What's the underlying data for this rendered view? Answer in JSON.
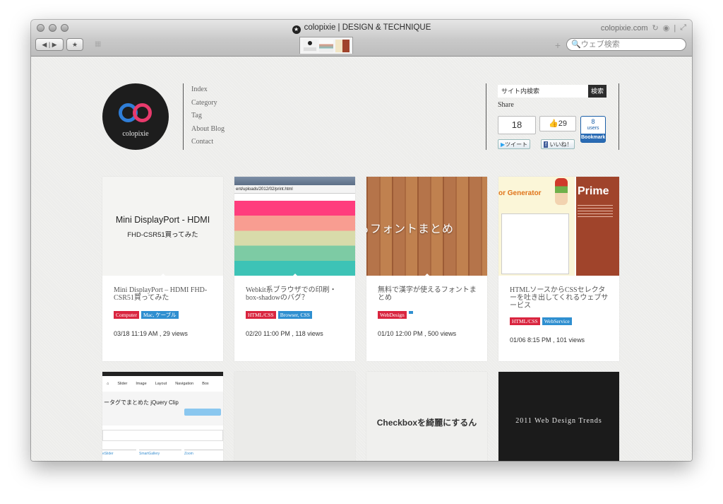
{
  "window": {
    "title": "colopixie | DESIGN & TECHNIQUE",
    "domain": "colopixie.com",
    "search_placeholder": "ウェブ検索"
  },
  "header": {
    "logo_text": "colopixie",
    "menu": [
      "Index",
      "Category",
      "Tag",
      "About Blog",
      "Contact"
    ]
  },
  "sidebar": {
    "search_value": "サイト内検索",
    "search_button": "検索",
    "share_label": "Share",
    "tweet_count": "18",
    "tweet_button": "ツイート",
    "like_count": "29",
    "like_button": "いいね！",
    "hatena_count": "8",
    "hatena_users": "users",
    "hatena_button": "Bookmark"
  },
  "posts": [
    {
      "thumb_title": "Mini DisplayPort - HDMI",
      "thumb_sub": "FHD-CSR51買ってみた",
      "title": "Mini DisplayPort – HDMI FHD-CSR51買ってみた",
      "tags": [
        "Computer",
        "Mac, ケーブル"
      ],
      "meta": "03/18 11:19 AM , 29 views"
    },
    {
      "thumb_url": "ent/uploads/2012/02/print.html",
      "title": "Webkit系ブラウザでの印刷・box-shadowのバグ？",
      "tags": [
        "HTML/CSS",
        "Browser, CSS"
      ],
      "meta": "02/20 11:00 PM , 118 views"
    },
    {
      "thumb_text": "るフォントまとめ",
      "title": "無料で漢字が使えるフォントまとめ",
      "tags": [
        "WebDesign"
      ],
      "meta": "01/10 12:00 PM , 500 views"
    },
    {
      "thumb_brand": "Prime",
      "thumb_generator": "or Generator",
      "title": "HTMLソースからCSSセレクターを吐き出してくれるウェブサービス",
      "tags": [
        "HTML/CSS",
        "WebService"
      ],
      "meta": "01/06 8:15 PM , 101 views"
    },
    {
      "thumb_heading": "ータグでまとめた jQuery Clip",
      "thumb_nav": [
        "Slider",
        "Image",
        "Layout",
        "Navigation",
        "Box"
      ],
      "thumb_tabs": [
        "eSlider",
        "SmartGallery",
        "Zoom"
      ]
    },
    {},
    {
      "thumb_text": "Checkboxを綺麗にするん"
    },
    {
      "thumb_text": "2011 Web Design Trends"
    }
  ]
}
